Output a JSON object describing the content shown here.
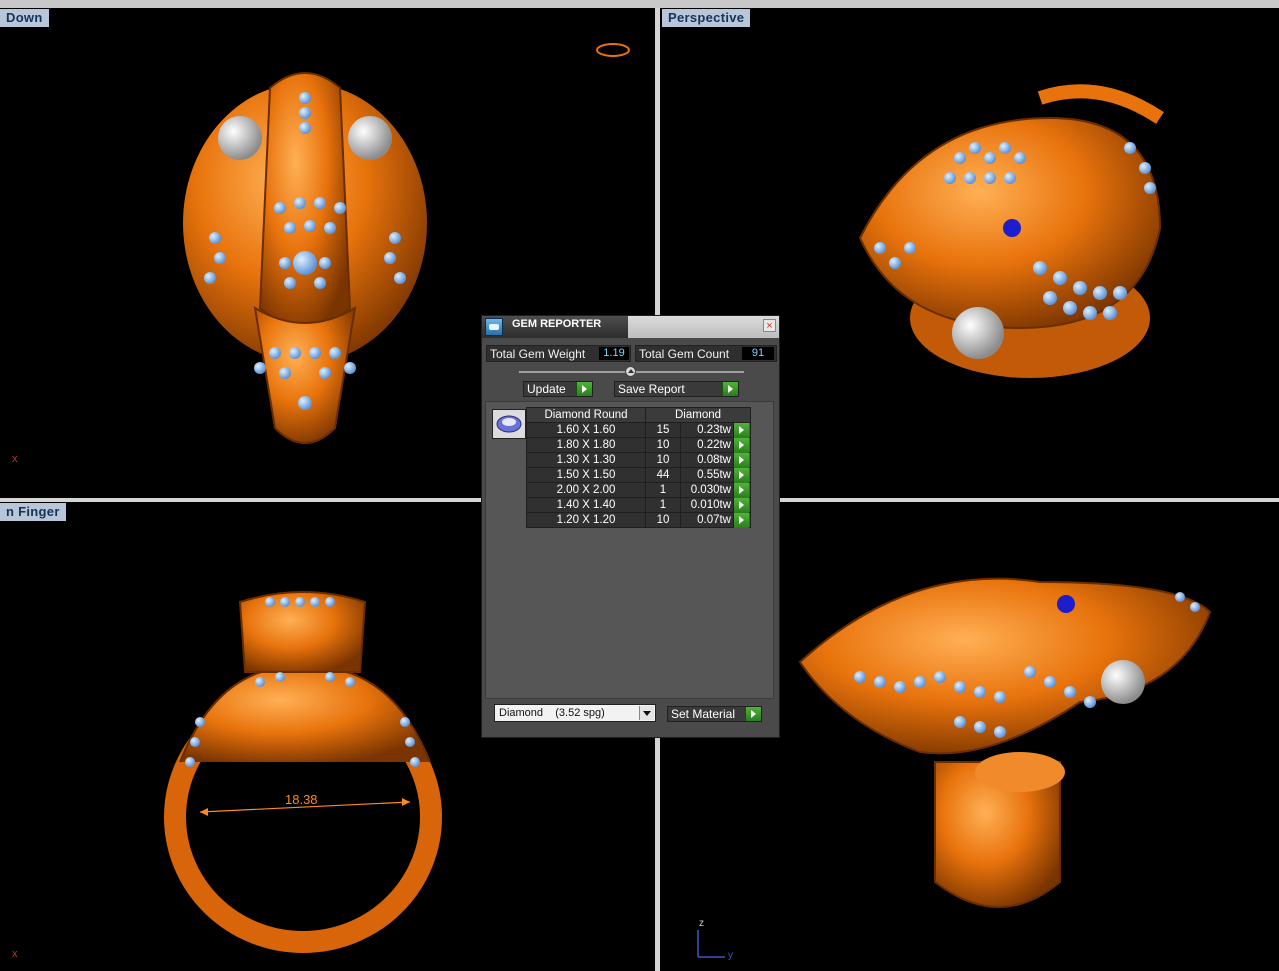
{
  "viewports": {
    "top_left": {
      "label": "Down"
    },
    "top_right": {
      "label": "Perspective"
    },
    "bottom_left": {
      "label": "n Finger",
      "dimension": "18.38"
    },
    "bottom_right": {
      "axis_z": "z",
      "axis_y": "y"
    },
    "axis_x": "x"
  },
  "dialog": {
    "title": "GEM REPORTER",
    "close": "×",
    "total_weight_label": "Total Gem Weight",
    "total_weight_value": "1.19",
    "total_count_label": "Total Gem Count",
    "total_count_value": "91",
    "update_label": "Update",
    "save_report_label": "Save Report",
    "table": {
      "header_shape": "Diamond Round",
      "header_material": "Diamond",
      "rows": [
        {
          "size": "1.60 X 1.60",
          "count": "15",
          "weight": "0.23tw"
        },
        {
          "size": "1.80 X 1.80",
          "count": "10",
          "weight": "0.22tw"
        },
        {
          "size": "1.30 X 1.30",
          "count": "10",
          "weight": "0.08tw"
        },
        {
          "size": "1.50 X 1.50",
          "count": "44",
          "weight": "0.55tw"
        },
        {
          "size": "2.00 X 2.00",
          "count": "1",
          "weight": "0.030tw"
        },
        {
          "size": "1.40 X 1.40",
          "count": "1",
          "weight": "0.010tw"
        },
        {
          "size": "1.20 X 1.20",
          "count": "10",
          "weight": "0.07tw"
        }
      ]
    },
    "material_select": "Diamond    (3.52 spg)",
    "set_material_label": "Set Material"
  },
  "colors": {
    "gold": "#e8730c",
    "gem": "#7fb2e8",
    "label_bg": "#b7c6d8",
    "button_green": "#3a9a2a"
  }
}
